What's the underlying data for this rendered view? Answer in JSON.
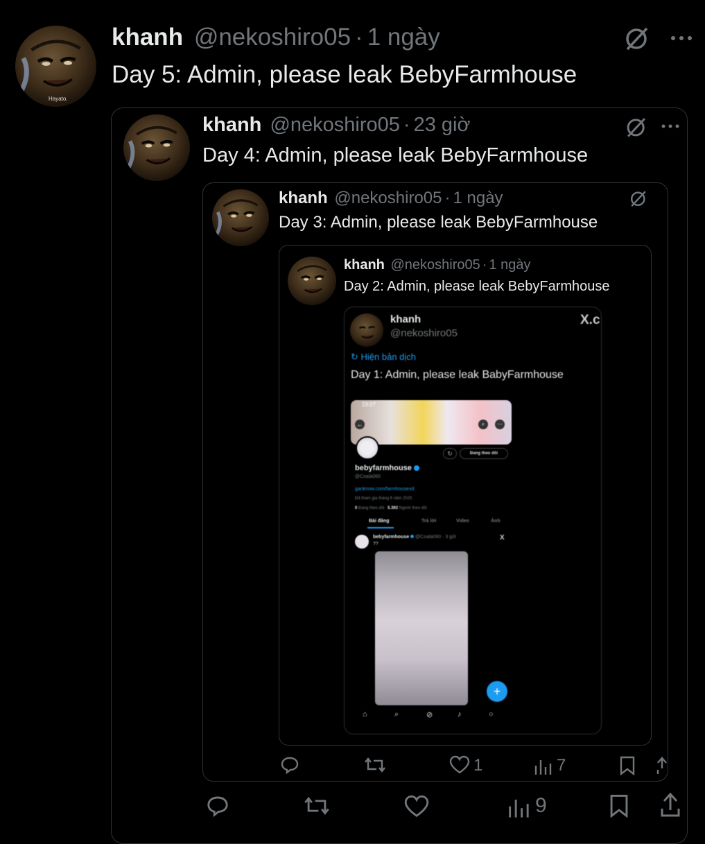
{
  "day5": {
    "name": "khanh",
    "handle": "@nekoshiro05",
    "sep": "·",
    "time": "1 ngày",
    "text": "Day 5: Admin, please leak BebyFarmhouse",
    "avatar_caption": "Hayato.",
    "action_counts": {
      "like": "",
      "views": "9"
    }
  },
  "day4": {
    "name": "khanh",
    "handle": "@nekoshiro05",
    "sep": "·",
    "time": "23 giờ",
    "text": "Day 4: Admin, please leak BebyFarmhouse"
  },
  "day3": {
    "name": "khanh",
    "handle": "@nekoshiro05",
    "sep": "·",
    "time": "1 ngày",
    "text": "Day 3: Admin, please leak BebyFarmhouse",
    "action_counts": {
      "like": "1",
      "views": "7"
    }
  },
  "day2": {
    "name": "khanh",
    "handle": "@nekoshiro05",
    "sep": "·",
    "time": "1 ngày",
    "text": "Day 2: Admin, please leak BebyFarmhouse"
  },
  "day1": {
    "name": "khanh",
    "handle": "@nekoshiro05",
    "x_logo": "X.c",
    "translate": "Hiện bản dịch",
    "text": "Day 1: Admin, please leak BabyFarmhouse"
  },
  "profile": {
    "status_time": "23:07",
    "follow_button": "Đang theo dõi",
    "display_name": "bebyfarmhouse",
    "username": "@Coala060",
    "link": "ganknow.com/farmhousexd",
    "joined": "Đã tham gia tháng 6 năm 2025",
    "following_count": "0",
    "following_label": "Đang theo dõi",
    "followers_count": "5.392",
    "followers_label": "Người theo dõi",
    "tabs": [
      "Bài đăng",
      "Trả lời",
      "Video",
      "Ảnh"
    ],
    "post_author": "bebyfarmhouse",
    "post_meta": "@Coala060 · 3 giờ",
    "post_text": "??",
    "post_close": "X"
  },
  "colors": {
    "background": "#000000",
    "border": "#2f3336",
    "text_primary": "#e7e9ea",
    "text_secondary": "#71767b",
    "accent": "#1d9bf0"
  }
}
